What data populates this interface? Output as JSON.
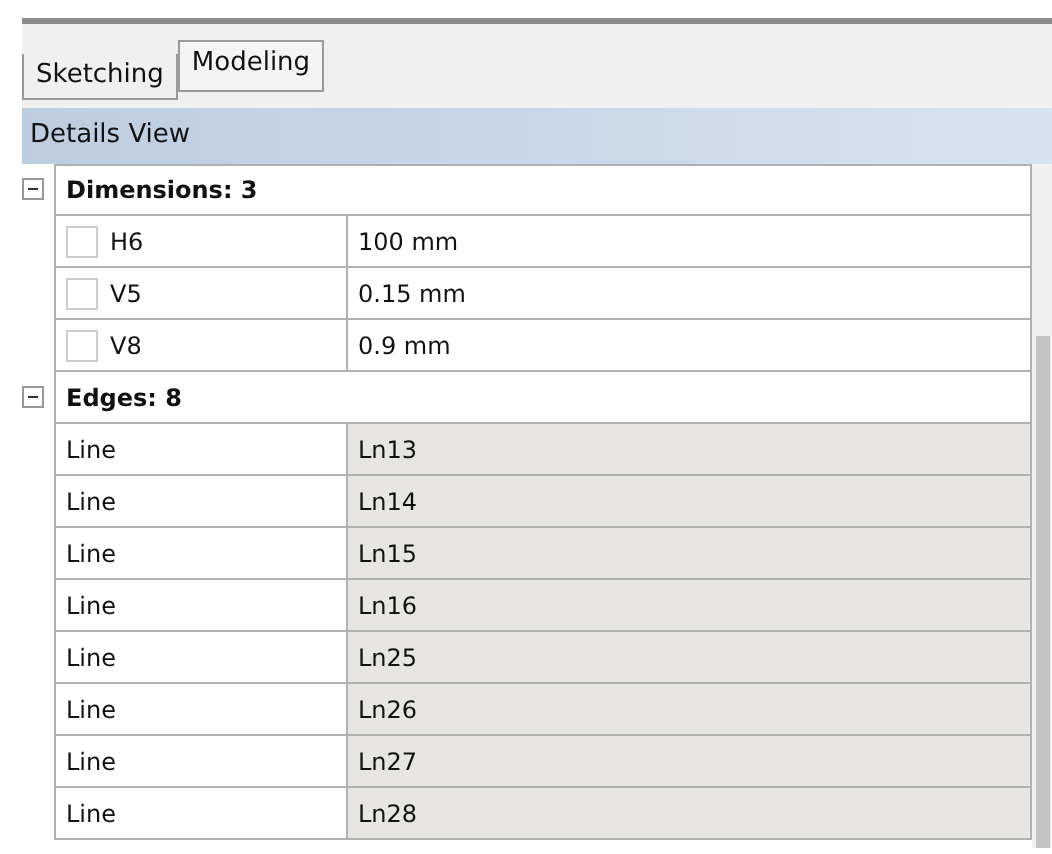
{
  "tabs": [
    {
      "label": "Sketching",
      "selected": false
    },
    {
      "label": "Modeling",
      "selected": true
    }
  ],
  "panel": {
    "title": "Details View"
  },
  "groups": [
    {
      "label": "Dimensions: 3",
      "expanded": true,
      "rows": [
        {
          "kind": "checkbox",
          "checked": false,
          "name": "H6",
          "value": "100 mm"
        },
        {
          "kind": "checkbox",
          "checked": false,
          "name": "V5",
          "value": "0.15 mm"
        },
        {
          "kind": "checkbox",
          "checked": false,
          "name": "V8",
          "value": "0.9 mm"
        }
      ]
    },
    {
      "label": "Edges: 8",
      "expanded": true,
      "rows": [
        {
          "kind": "readonly",
          "name": "Line",
          "value": "Ln13"
        },
        {
          "kind": "readonly",
          "name": "Line",
          "value": "Ln14"
        },
        {
          "kind": "readonly",
          "name": "Line",
          "value": "Ln15"
        },
        {
          "kind": "readonly",
          "name": "Line",
          "value": "Ln16"
        },
        {
          "kind": "readonly",
          "name": "Line",
          "value": "Ln25"
        },
        {
          "kind": "readonly",
          "name": "Line",
          "value": "Ln26"
        },
        {
          "kind": "readonly",
          "name": "Line",
          "value": "Ln27"
        },
        {
          "kind": "readonly",
          "name": "Line",
          "value": "Ln28"
        }
      ]
    }
  ]
}
